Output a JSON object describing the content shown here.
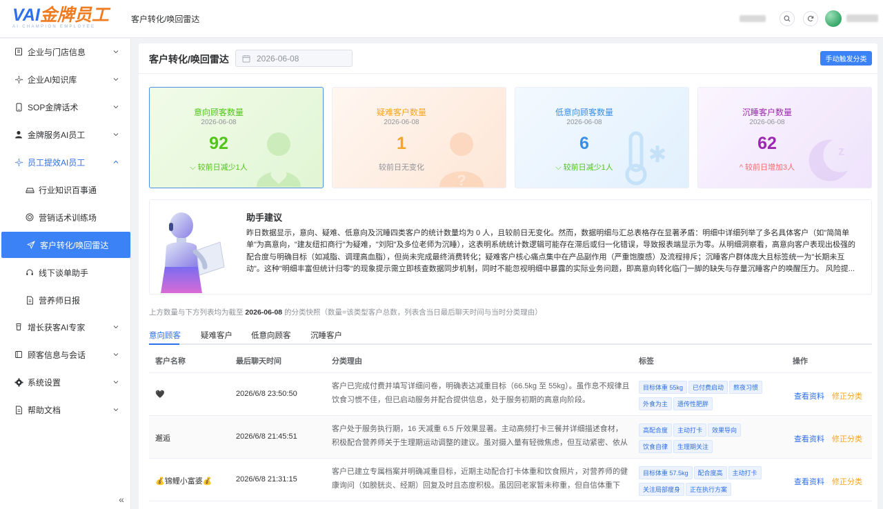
{
  "header": {
    "logo_text": "VAI金牌员工",
    "logo_sub": "AI CHAMPION EMPLOYEE",
    "breadcrumb": "客户转化/唤回雷达"
  },
  "sidebar": {
    "items": [
      {
        "label": "企业与门店信息",
        "icon": "building-icon"
      },
      {
        "label": "企业AI知识库",
        "icon": "sparkle-icon"
      },
      {
        "label": "SOP金牌话术",
        "icon": "phone-icon"
      },
      {
        "label": "金牌服务AI员工",
        "icon": "person-icon"
      },
      {
        "label": "员工提效AI员工",
        "icon": "sparkle-icon"
      },
      {
        "label": "行业知识百事通",
        "icon": "car-icon"
      },
      {
        "label": "营销话术训练场",
        "icon": "target-icon"
      },
      {
        "label": "客户转化/唤回雷达",
        "icon": "send-icon"
      },
      {
        "label": "线下谈单助手",
        "icon": "headset-icon"
      },
      {
        "label": "营养师日报",
        "icon": "document-icon"
      },
      {
        "label": "增长获客AI专家",
        "icon": "cup-icon"
      },
      {
        "label": "顾客信息与会话",
        "icon": "book-icon"
      },
      {
        "label": "系统设置",
        "icon": "gear-icon"
      },
      {
        "label": "帮助文档",
        "icon": "document-icon"
      }
    ]
  },
  "page": {
    "title": "客户转化/唤回雷达",
    "date": "2026-06-08",
    "trigger_button": "手动触发分类"
  },
  "cards": [
    {
      "title": "意向顾客数量",
      "date": "2026-06-08",
      "value": "92",
      "change": "较前日减少1人",
      "trend": "down",
      "color": "#52c41a"
    },
    {
      "title": "疑难客户数量",
      "date": "2026-06-08",
      "value": "1",
      "change": "较前日无变化",
      "trend": "none",
      "color": "#f5a623"
    },
    {
      "title": "低意向顾客数量",
      "date": "2026-06-08",
      "value": "6",
      "change": "较前日减少1人",
      "trend": "down",
      "color": "#3a8ee6"
    },
    {
      "title": "沉睡客户数量",
      "date": "2026-06-08",
      "value": "62",
      "change": "较前日增加3人",
      "trend": "up",
      "color": "#9c27b0"
    }
  ],
  "assistant": {
    "title": "助手建议",
    "body": "昨日数据显示，意向、疑难、低意向及沉睡四类客户的统计数量均为 0 人，且较前日无变化。然而，数据明细与汇总表格存在显著矛盾：明细中详细列举了多名具体客户（如\"简简单单\"为高意向，\"建友纽扣商行\"为疑难，\"刘阳\"及多位老师为沉睡），这表明系统统计数逻辑可能存在滞后或归一化错误，导致报表端显示为零。从明细洞察看，高意向客户表现出极强的配合度与明确目标（如减脂、调理高血脂），但尚未完成最终消费转化；疑难客户核心痛点集中在产品副作用（严重饱腹感）及流程排斥；沉睡客户群体庞大且标签统一为\"长期未互动\"。这种\"明细丰富但统计归零\"的现象提示需立即核查数据同步机制，同时不能忽视明细中暴露的实际业务问题，即高意向转化临门一脚的缺失与存量沉睡客户的唤醒压力。 风险提..."
  },
  "note": {
    "prefix": "上方数量与下方列表均为截至",
    "date": "2026-06-08",
    "suffix": "的分类快照（数量=该类型客户总数，列表含当日最后聊天时间与当时分类理由）"
  },
  "tabs": [
    "意向顾客",
    "疑难客户",
    "低意向顾客",
    "沉睡客户"
  ],
  "table": {
    "columns": [
      "客户名称",
      "最后聊天时间",
      "分类理由",
      "标签",
      "操作"
    ],
    "view_label": "查看资料",
    "fix_label": "修正分类",
    "rows": [
      {
        "name": "🖤",
        "time": "2026/6/8 23:50:50",
        "reason": "客户已完成付费并填写详细问卷，明确表达减重目标（66.5kg 至 55kg）。虽作息不规律且饮食习惯不佳，但已启动服务并配合提供信息，处于服务初期的高意向阶段。",
        "tags": [
          "目标体重 55kg",
          "已付费启动",
          "熬夜习惯",
          "外食为主",
          "遗传性肥胖"
        ]
      },
      {
        "name": "邂逅",
        "time": "2026/6/8 21:45:51",
        "reason": "客户处于服务执行期，16 天减重 6.5 斤效果显著。主动高频打卡三餐并详细描述食材，积极配合营养师关于生理期运动调整的建议。虽对摄入量有轻微焦虑，但互动紧密、依从性高，属于高意向客户。",
        "tags": [
          "高配合度",
          "主动打卡",
          "效果导向",
          "饮食自律",
          "生理期关注"
        ]
      },
      {
        "name": "💰锦鲤小富婆💰",
        "time": "2026/6/8 21:31:15",
        "reason": "客户已建立专属档案并明确减重目标，近期主动配合打卡体重和饮食照片，对营养师的健康询问（如膀胱炎、经期）回复及时且态度积极。虽因回老家暂未称重，但自信体重下降，整体依从性良好。",
        "tags": [
          "目标体重 57.5kg",
          "配合度高",
          "主动打卡",
          "关注局部瘦身",
          "正在执行方案"
        ]
      }
    ]
  }
}
